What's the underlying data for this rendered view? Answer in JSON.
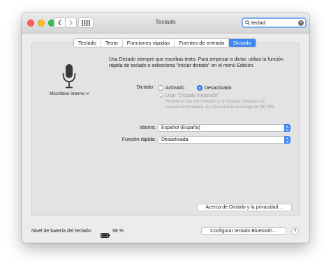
{
  "window": {
    "title": "Teclado"
  },
  "search": {
    "value": "teclad"
  },
  "tabs": [
    {
      "label": "Teclado"
    },
    {
      "label": "Texto"
    },
    {
      "label": "Funciones rápidas"
    },
    {
      "label": "Fuentes de entrada"
    },
    {
      "label": "Dictado"
    }
  ],
  "active_tab": "Dictado",
  "mic": {
    "label": "Micrófono interno"
  },
  "description": "Usa Dictado siempre que escribas texto. Para empezar a dictar, utiliza la función rápida de teclado o selecciona \"Iniciar dictado\" en el menú Edición.",
  "dictation": {
    "label": "Dictado:",
    "option_on": "Activado",
    "option_off": "Desactivado",
    "selected": "Desactivado",
    "enhanced_label": "Usar \"Dictado mejorado\"",
    "enhanced_note": "Permite el uso sin conexión y un dictado continuo con respuesta inmediata. Es necesaria la descarga de 842 MB."
  },
  "language": {
    "label": "Idioma:",
    "value": "Español (España)"
  },
  "shortcut": {
    "label": "Función rápida:",
    "value": "Desactivada"
  },
  "buttons": {
    "about": "Acerca de Dictado y la privacidad…",
    "bluetooth": "Configurar teclado Bluetooth…",
    "help": "?"
  },
  "battery": {
    "label": "Nivel de batería del teclado:",
    "percent": "98 %",
    "level": 0.98
  },
  "colors": {
    "accent": "#3d86f5"
  },
  "icons": [
    "back-icon",
    "forward-icon",
    "grid-icon",
    "search-icon",
    "clear-icon",
    "microphone-icon",
    "chevron-down-icon",
    "battery-icon"
  ]
}
